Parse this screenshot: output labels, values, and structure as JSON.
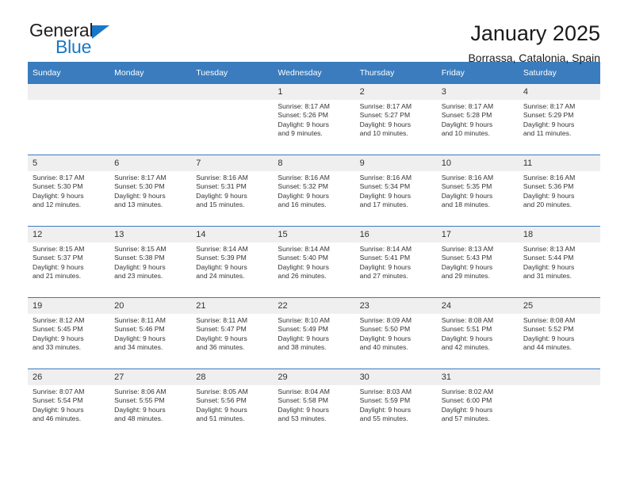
{
  "brand": {
    "name_part1": "General",
    "name_part2": "Blue",
    "accent_color": "#1878c8"
  },
  "header": {
    "title": "January 2025",
    "subtitle": "Borrassa, Catalonia, Spain"
  },
  "calendar": {
    "header_color": "#3a7cbe",
    "weekday_headers": [
      "Sunday",
      "Monday",
      "Tuesday",
      "Wednesday",
      "Thursday",
      "Friday",
      "Saturday"
    ],
    "weeks": [
      [
        {
          "day": "",
          "sunrise": "",
          "sunset": "",
          "daylight_line1": "",
          "daylight_line2": ""
        },
        {
          "day": "",
          "sunrise": "",
          "sunset": "",
          "daylight_line1": "",
          "daylight_line2": ""
        },
        {
          "day": "",
          "sunrise": "",
          "sunset": "",
          "daylight_line1": "",
          "daylight_line2": ""
        },
        {
          "day": "1",
          "sunrise": "Sunrise: 8:17 AM",
          "sunset": "Sunset: 5:26 PM",
          "daylight_line1": "Daylight: 9 hours",
          "daylight_line2": "and 9 minutes."
        },
        {
          "day": "2",
          "sunrise": "Sunrise: 8:17 AM",
          "sunset": "Sunset: 5:27 PM",
          "daylight_line1": "Daylight: 9 hours",
          "daylight_line2": "and 10 minutes."
        },
        {
          "day": "3",
          "sunrise": "Sunrise: 8:17 AM",
          "sunset": "Sunset: 5:28 PM",
          "daylight_line1": "Daylight: 9 hours",
          "daylight_line2": "and 10 minutes."
        },
        {
          "day": "4",
          "sunrise": "Sunrise: 8:17 AM",
          "sunset": "Sunset: 5:29 PM",
          "daylight_line1": "Daylight: 9 hours",
          "daylight_line2": "and 11 minutes."
        }
      ],
      [
        {
          "day": "5",
          "sunrise": "Sunrise: 8:17 AM",
          "sunset": "Sunset: 5:30 PM",
          "daylight_line1": "Daylight: 9 hours",
          "daylight_line2": "and 12 minutes."
        },
        {
          "day": "6",
          "sunrise": "Sunrise: 8:17 AM",
          "sunset": "Sunset: 5:30 PM",
          "daylight_line1": "Daylight: 9 hours",
          "daylight_line2": "and 13 minutes."
        },
        {
          "day": "7",
          "sunrise": "Sunrise: 8:16 AM",
          "sunset": "Sunset: 5:31 PM",
          "daylight_line1": "Daylight: 9 hours",
          "daylight_line2": "and 15 minutes."
        },
        {
          "day": "8",
          "sunrise": "Sunrise: 8:16 AM",
          "sunset": "Sunset: 5:32 PM",
          "daylight_line1": "Daylight: 9 hours",
          "daylight_line2": "and 16 minutes."
        },
        {
          "day": "9",
          "sunrise": "Sunrise: 8:16 AM",
          "sunset": "Sunset: 5:34 PM",
          "daylight_line1": "Daylight: 9 hours",
          "daylight_line2": "and 17 minutes."
        },
        {
          "day": "10",
          "sunrise": "Sunrise: 8:16 AM",
          "sunset": "Sunset: 5:35 PM",
          "daylight_line1": "Daylight: 9 hours",
          "daylight_line2": "and 18 minutes."
        },
        {
          "day": "11",
          "sunrise": "Sunrise: 8:16 AM",
          "sunset": "Sunset: 5:36 PM",
          "daylight_line1": "Daylight: 9 hours",
          "daylight_line2": "and 20 minutes."
        }
      ],
      [
        {
          "day": "12",
          "sunrise": "Sunrise: 8:15 AM",
          "sunset": "Sunset: 5:37 PM",
          "daylight_line1": "Daylight: 9 hours",
          "daylight_line2": "and 21 minutes."
        },
        {
          "day": "13",
          "sunrise": "Sunrise: 8:15 AM",
          "sunset": "Sunset: 5:38 PM",
          "daylight_line1": "Daylight: 9 hours",
          "daylight_line2": "and 23 minutes."
        },
        {
          "day": "14",
          "sunrise": "Sunrise: 8:14 AM",
          "sunset": "Sunset: 5:39 PM",
          "daylight_line1": "Daylight: 9 hours",
          "daylight_line2": "and 24 minutes."
        },
        {
          "day": "15",
          "sunrise": "Sunrise: 8:14 AM",
          "sunset": "Sunset: 5:40 PM",
          "daylight_line1": "Daylight: 9 hours",
          "daylight_line2": "and 26 minutes."
        },
        {
          "day": "16",
          "sunrise": "Sunrise: 8:14 AM",
          "sunset": "Sunset: 5:41 PM",
          "daylight_line1": "Daylight: 9 hours",
          "daylight_line2": "and 27 minutes."
        },
        {
          "day": "17",
          "sunrise": "Sunrise: 8:13 AM",
          "sunset": "Sunset: 5:43 PM",
          "daylight_line1": "Daylight: 9 hours",
          "daylight_line2": "and 29 minutes."
        },
        {
          "day": "18",
          "sunrise": "Sunrise: 8:13 AM",
          "sunset": "Sunset: 5:44 PM",
          "daylight_line1": "Daylight: 9 hours",
          "daylight_line2": "and 31 minutes."
        }
      ],
      [
        {
          "day": "19",
          "sunrise": "Sunrise: 8:12 AM",
          "sunset": "Sunset: 5:45 PM",
          "daylight_line1": "Daylight: 9 hours",
          "daylight_line2": "and 33 minutes."
        },
        {
          "day": "20",
          "sunrise": "Sunrise: 8:11 AM",
          "sunset": "Sunset: 5:46 PM",
          "daylight_line1": "Daylight: 9 hours",
          "daylight_line2": "and 34 minutes."
        },
        {
          "day": "21",
          "sunrise": "Sunrise: 8:11 AM",
          "sunset": "Sunset: 5:47 PM",
          "daylight_line1": "Daylight: 9 hours",
          "daylight_line2": "and 36 minutes."
        },
        {
          "day": "22",
          "sunrise": "Sunrise: 8:10 AM",
          "sunset": "Sunset: 5:49 PM",
          "daylight_line1": "Daylight: 9 hours",
          "daylight_line2": "and 38 minutes."
        },
        {
          "day": "23",
          "sunrise": "Sunrise: 8:09 AM",
          "sunset": "Sunset: 5:50 PM",
          "daylight_line1": "Daylight: 9 hours",
          "daylight_line2": "and 40 minutes."
        },
        {
          "day": "24",
          "sunrise": "Sunrise: 8:08 AM",
          "sunset": "Sunset: 5:51 PM",
          "daylight_line1": "Daylight: 9 hours",
          "daylight_line2": "and 42 minutes."
        },
        {
          "day": "25",
          "sunrise": "Sunrise: 8:08 AM",
          "sunset": "Sunset: 5:52 PM",
          "daylight_line1": "Daylight: 9 hours",
          "daylight_line2": "and 44 minutes."
        }
      ],
      [
        {
          "day": "26",
          "sunrise": "Sunrise: 8:07 AM",
          "sunset": "Sunset: 5:54 PM",
          "daylight_line1": "Daylight: 9 hours",
          "daylight_line2": "and 46 minutes."
        },
        {
          "day": "27",
          "sunrise": "Sunrise: 8:06 AM",
          "sunset": "Sunset: 5:55 PM",
          "daylight_line1": "Daylight: 9 hours",
          "daylight_line2": "and 48 minutes."
        },
        {
          "day": "28",
          "sunrise": "Sunrise: 8:05 AM",
          "sunset": "Sunset: 5:56 PM",
          "daylight_line1": "Daylight: 9 hours",
          "daylight_line2": "and 51 minutes."
        },
        {
          "day": "29",
          "sunrise": "Sunrise: 8:04 AM",
          "sunset": "Sunset: 5:58 PM",
          "daylight_line1": "Daylight: 9 hours",
          "daylight_line2": "and 53 minutes."
        },
        {
          "day": "30",
          "sunrise": "Sunrise: 8:03 AM",
          "sunset": "Sunset: 5:59 PM",
          "daylight_line1": "Daylight: 9 hours",
          "daylight_line2": "and 55 minutes."
        },
        {
          "day": "31",
          "sunrise": "Sunrise: 8:02 AM",
          "sunset": "Sunset: 6:00 PM",
          "daylight_line1": "Daylight: 9 hours",
          "daylight_line2": "and 57 minutes."
        },
        {
          "day": "",
          "sunrise": "",
          "sunset": "",
          "daylight_line1": "",
          "daylight_line2": ""
        }
      ]
    ]
  }
}
